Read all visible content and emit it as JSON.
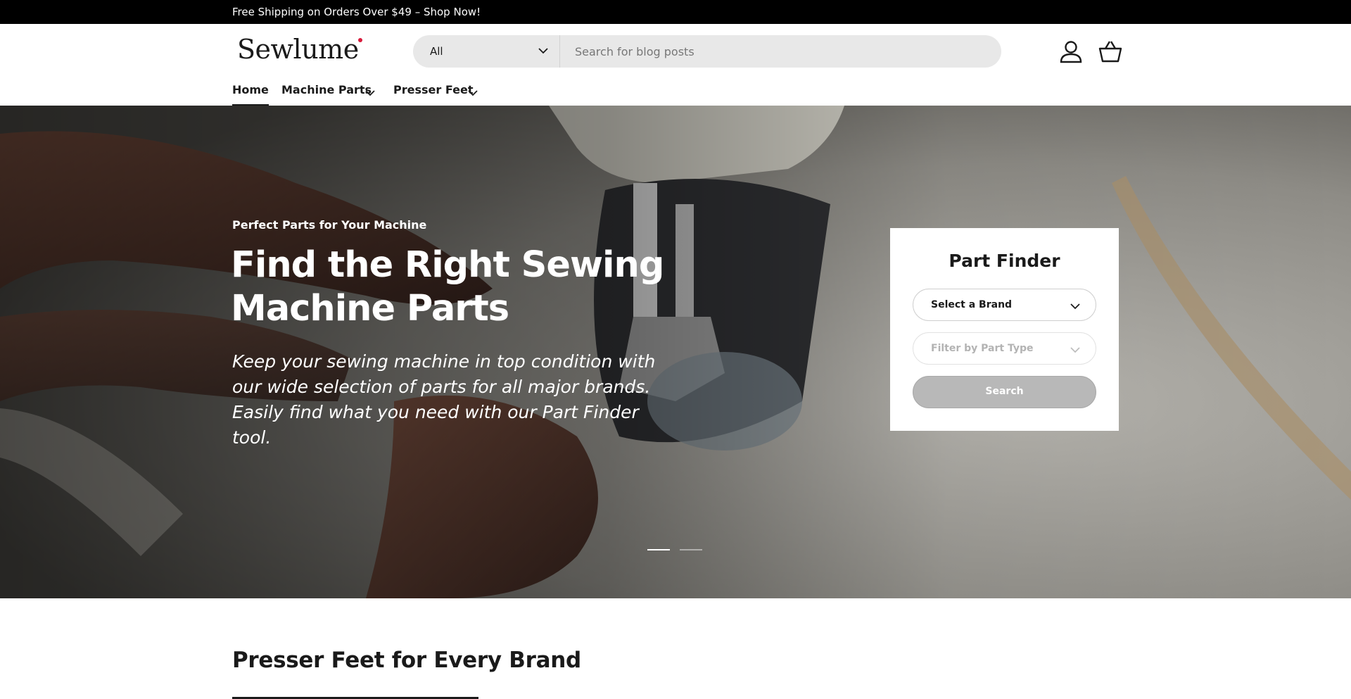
{
  "announcement": {
    "text": "Free Shipping on Orders Over $49 – Shop Now!"
  },
  "header": {
    "logo": "Sewlume",
    "search": {
      "category": "All",
      "placeholder": "Search for blog posts"
    },
    "icons": [
      "account-icon",
      "cart-icon",
      "microphone-icon"
    ]
  },
  "nav": {
    "items": [
      {
        "label": "Home",
        "active": true
      },
      {
        "label": "Machine Parts",
        "has_dropdown": true
      },
      {
        "label": "Presser Feet",
        "has_dropdown": true
      }
    ]
  },
  "hero": {
    "eyebrow": "Perfect Parts for Your Machine",
    "title": "Find the Right Sewing Machine Parts",
    "subtitle": "Keep your sewing machine in top condition with our wide selection of parts for all major brands. Easily find what you need with our Part Finder tool.",
    "slides": 2,
    "active_slide": 1
  },
  "part_finder": {
    "title": "Part Finder",
    "brand_select": "Select a Brand",
    "type_select": "Filter by Part Type",
    "button": "Search"
  },
  "section": {
    "title": "Presser Feet for Every Brand"
  },
  "colors": {
    "accent": "#d81b3c",
    "announcement_bg": "#000000",
    "button_disabled": "#b8b8b8"
  }
}
